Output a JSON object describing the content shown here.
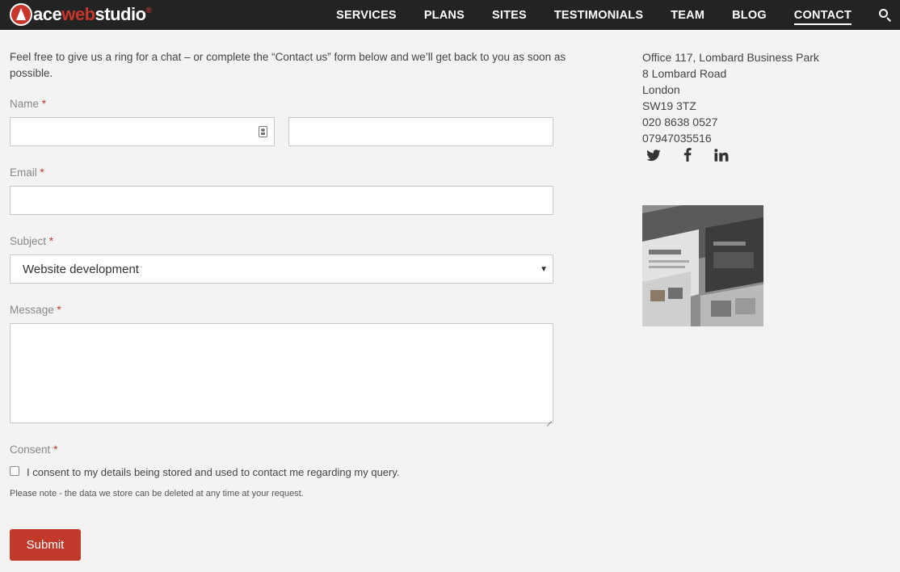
{
  "brand": {
    "ace": "ace",
    "web": "web",
    "studio": "studio",
    "reg": "®"
  },
  "nav": {
    "items": [
      "SERVICES",
      "PLANS",
      "SITES",
      "TESTIMONIALS",
      "TEAM",
      "BLOG",
      "CONTACT"
    ],
    "active": "CONTACT"
  },
  "intro": "Feel free to give us a ring for a chat – or complete the “Contact us” form below and we’ll get back to you as soon as possible.",
  "form": {
    "name_label": "Name",
    "email_label": "Email",
    "subject_label": "Subject",
    "subject_value": "Website development",
    "message_label": "Message",
    "consent_label": "Consent",
    "required_mark": "*",
    "consent_text": "I consent to my details being stored and used to contact me regarding my query.",
    "note": "Please note - the data we store can be deleted at any time at your request.",
    "submit_label": "Submit"
  },
  "sidebar": {
    "address_lines": [
      "Office 117, Lombard Business Park",
      "8 Lombard Road",
      "London",
      "SW19 3TZ",
      "020 8638 0527",
      "07947035516"
    ],
    "social": [
      "twitter-icon",
      "facebook-icon",
      "linkedin-icon"
    ]
  },
  "colors": {
    "accent": "#c0392b",
    "nav_bg": "#232323",
    "page_bg": "#f3f3f3"
  }
}
